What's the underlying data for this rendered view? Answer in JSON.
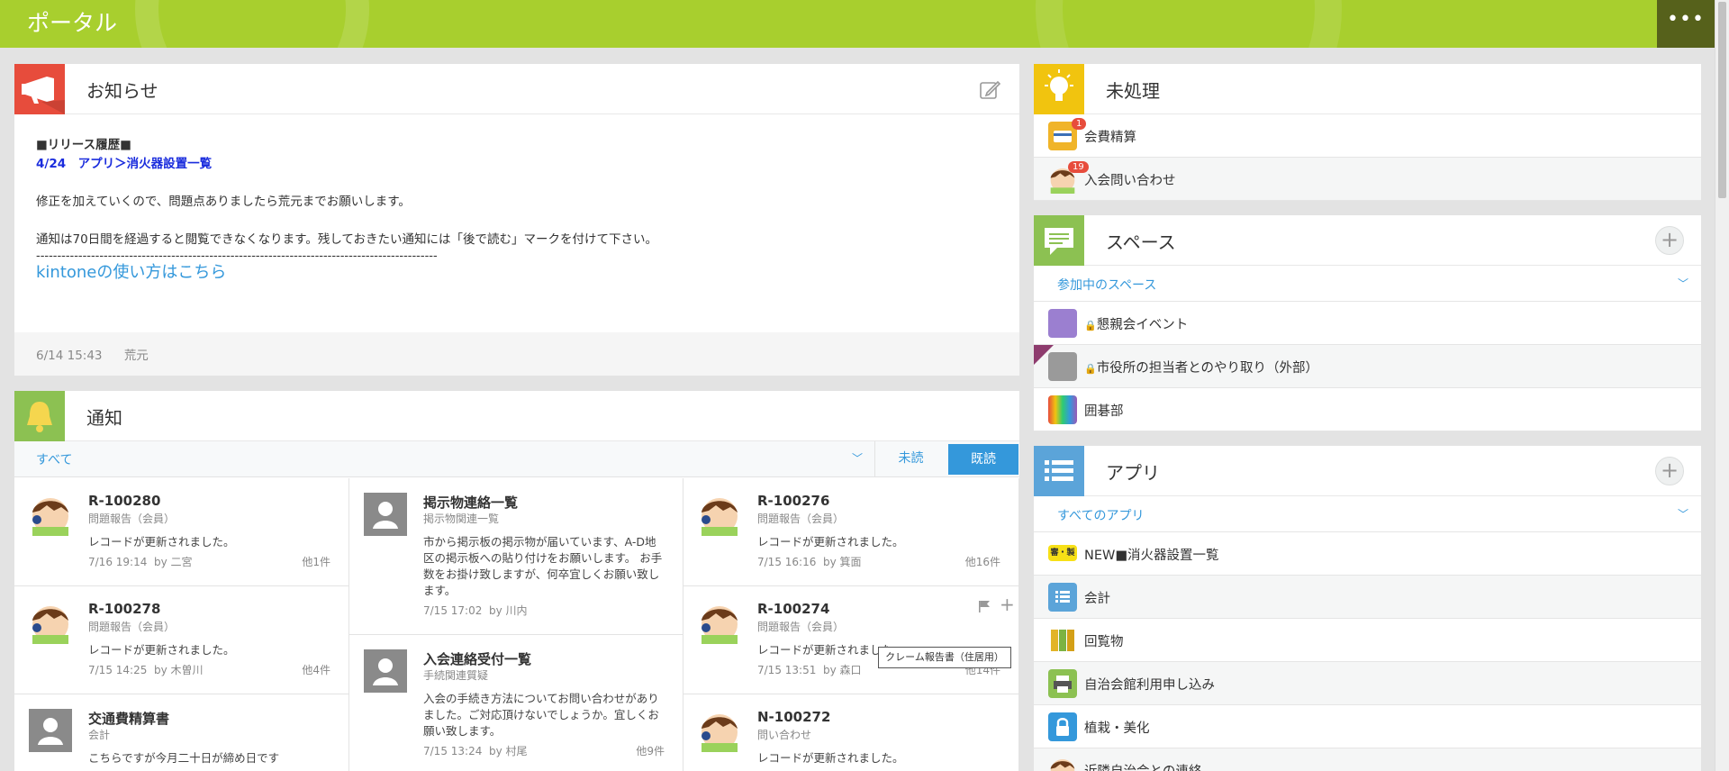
{
  "header": {
    "title": "ポータル",
    "menu_label": "•••"
  },
  "notice": {
    "title": "お知らせ",
    "release_heading": "■リリース履歴■",
    "release_line": "4/24　アプリ＞消火器設置一覧",
    "para1": "修正を加えていくので、問題点ありましたら荒元までお願いします。",
    "para2": "通知は70日間を経過すると閲覧できなくなります。残しておきたい通知には「後で読む」マークを付けて下さい。",
    "divider": "-----------------------------------------------------------------------------------------------",
    "link": "kintoneの使い方はこちら",
    "footer_date": "6/14 15:43",
    "footer_author": "荒元"
  },
  "notifications": {
    "title": "通知",
    "filter_all": "すべて",
    "filter_unread": "未読",
    "filter_read": "既読",
    "cards": [
      {
        "title": "R-100280",
        "sub": "問題報告（会員）",
        "body": "レコードが更新されました。",
        "date": "7/16 19:14",
        "by": "by 二宮",
        "count": "他1件"
      },
      {
        "title": "掲示物連絡一覧",
        "sub": "掲示物関連一覧",
        "body": "市から掲示板の掲示物が届いています、A-D地区の掲示板への貼り付けをお願いします。 お手数をお掛け致しますが、何卒宜しくお願い致します。",
        "date": "7/15 17:02",
        "by": "by 川内",
        "count": ""
      },
      {
        "title": "R-100276",
        "sub": "問題報告（会員）",
        "body": "レコードが更新されました。",
        "date": "7/15 16:16",
        "by": "by 箕面",
        "count": "他16件"
      },
      {
        "title": "R-100278",
        "sub": "問題報告（会員）",
        "body": "レコードが更新されました。",
        "date": "7/15 14:25",
        "by": "by 木曽川",
        "count": "他4件"
      },
      {
        "title": "入会連絡受付一覧",
        "sub": "手続関連質疑",
        "body": "入会の手続き方法についてお問い合わせがありました。ご対応頂けないでしょうか。宜しくお願い致します。",
        "date": "7/15 13:24",
        "by": "by 村尾",
        "count": "他9件"
      },
      {
        "title": "R-100274",
        "sub": "問題報告（会員）",
        "body": "レコードが更新されました。",
        "date": "7/15 13:51",
        "by": "by 森口",
        "count": "他14件"
      },
      {
        "title": "交通費精算書",
        "sub": "会計",
        "body": "こちらですが今月二十日が締め日です",
        "date": "",
        "by": "",
        "count": ""
      },
      {
        "title": "N-100272",
        "sub": "問い合わせ",
        "body": "レコードが更新されました。",
        "date": "",
        "by": "",
        "count": ""
      }
    ],
    "tooltip": "クレーム報告書（住居用）"
  },
  "pending": {
    "title": "未処理",
    "items": [
      {
        "label": "会費精算",
        "badge": "1"
      },
      {
        "label": "入会問い合わせ",
        "badge": "19"
      }
    ]
  },
  "spaces": {
    "title": "スペース",
    "filter": "参加中のスペース",
    "items": [
      {
        "label": "懇親会イベント"
      },
      {
        "label": "市役所の担当者とのやり取り（外部）"
      },
      {
        "label": "囲碁部"
      }
    ]
  },
  "apps": {
    "title": "アプリ",
    "filter": "すべてのアプリ",
    "items": [
      {
        "label": "NEW■消火器設置一覧",
        "icon_text": "審・製"
      },
      {
        "label": "会計"
      },
      {
        "label": "回覧物"
      },
      {
        "label": "自治会館利用申し込み"
      },
      {
        "label": "植栽・美化"
      },
      {
        "label": "近隣自治会との連絡"
      }
    ]
  },
  "colors": {
    "topbar": "#a8cf2e",
    "accent": "#3498db",
    "notice_icon": "#e74c3c",
    "pending_icon": "#f1c40f",
    "space_icon": "#8cc152"
  }
}
